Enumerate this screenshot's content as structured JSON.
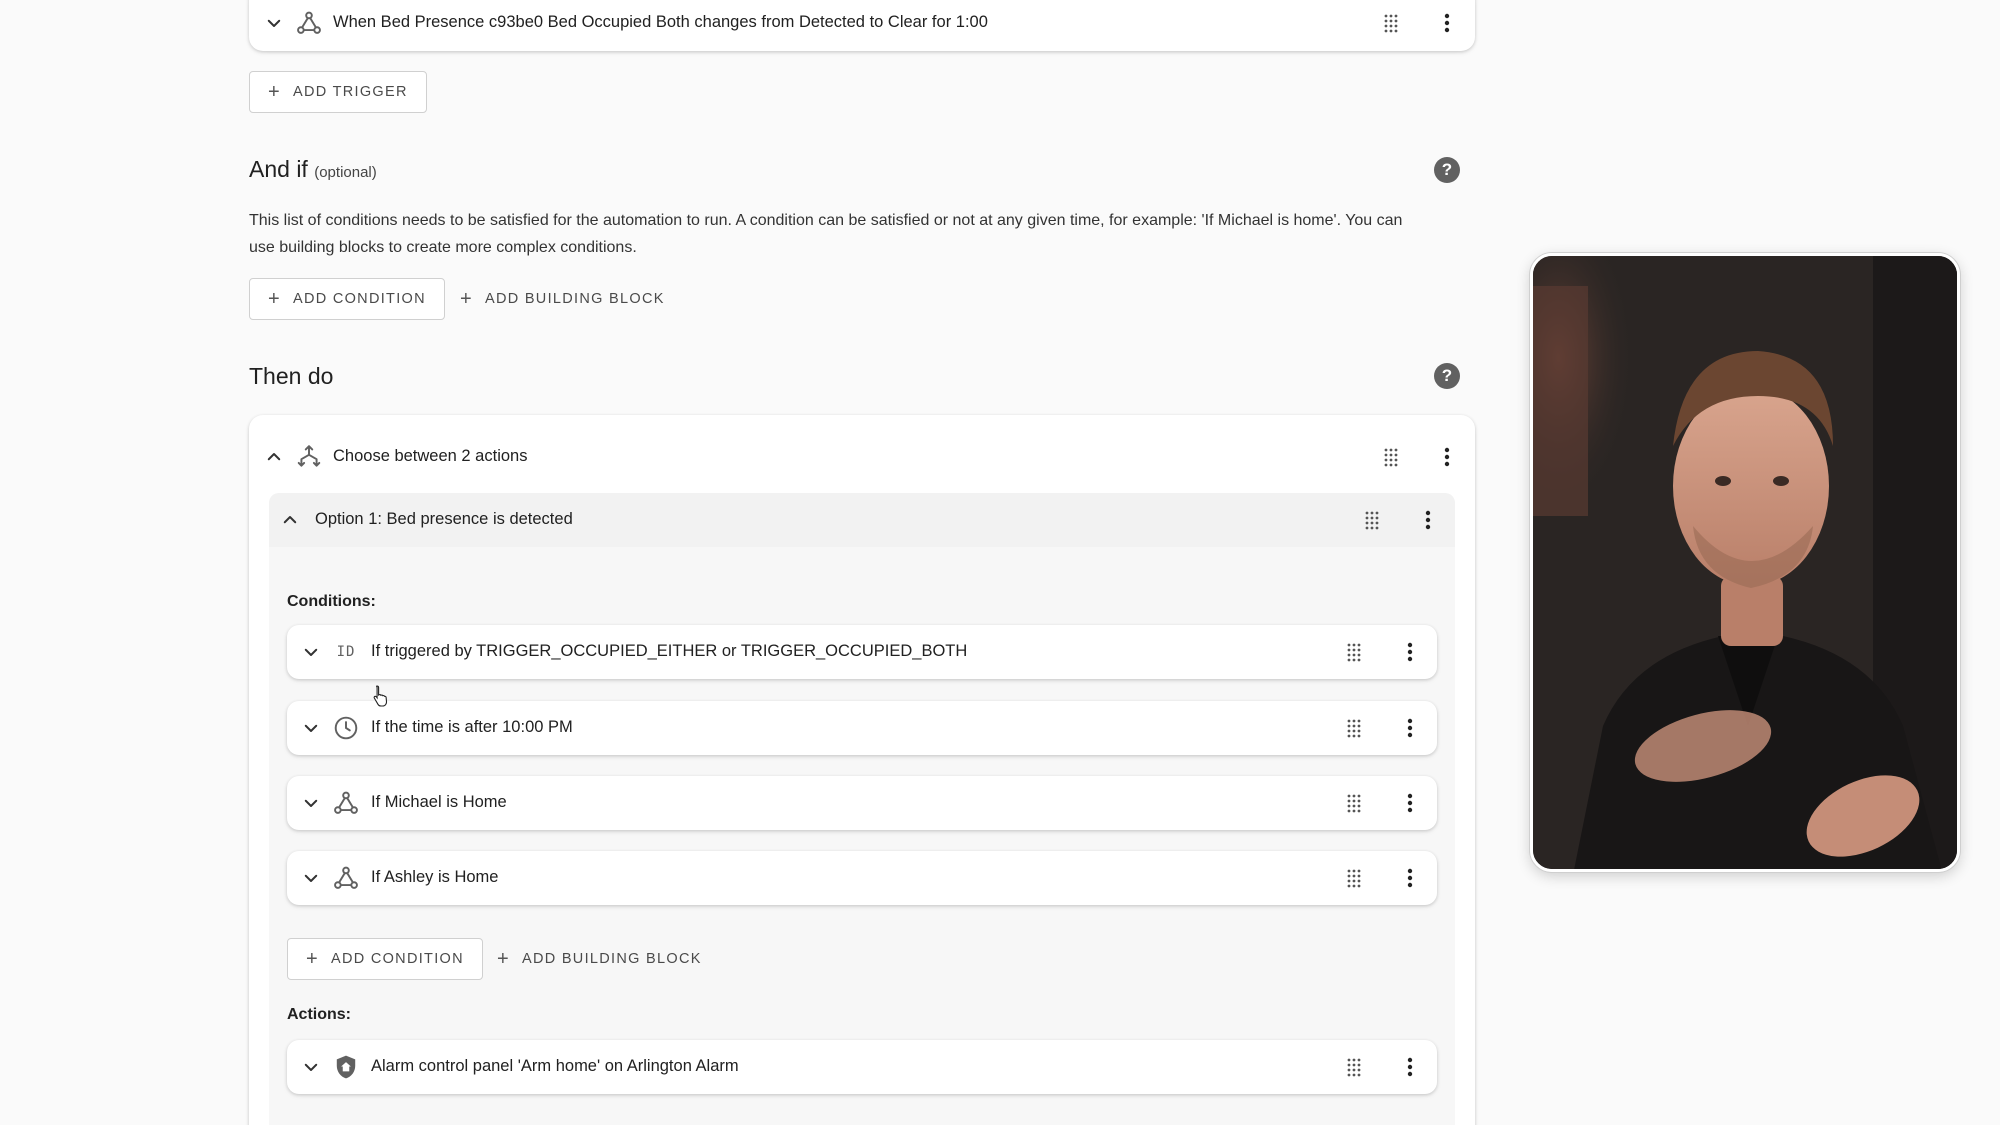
{
  "trigger": {
    "label": "When Bed Presence c93be0 Bed Occupied Both changes from Detected to Clear for 1:00",
    "add_trigger_label": "ADD TRIGGER"
  },
  "and_if": {
    "title": "And if",
    "optional": "(optional)",
    "description_line1": "This list of conditions needs to be satisfied for the automation to run. A condition can be satisfied or not at any given time, for example: 'If Michael is home'. You can",
    "description_line2": "use building blocks to create more complex conditions.",
    "add_condition_label": "ADD CONDITION",
    "add_building_block_label": "ADD BUILDING BLOCK"
  },
  "then_do": {
    "title": "Then do",
    "choose": {
      "label": "Choose between 2 actions",
      "option1": {
        "label": "Option 1: Bed presence is detected",
        "conditions_heading": "Conditions:",
        "conditions": [
          {
            "label": "If triggered by TRIGGER_OCCUPIED_EITHER or TRIGGER_OCCUPIED_BOTH",
            "icon": "id-icon"
          },
          {
            "label": "If the time is after 10:00 PM",
            "icon": "clock-icon"
          },
          {
            "label": "If Michael is Home",
            "icon": "device-hub-icon"
          },
          {
            "label": "If Ashley is Home",
            "icon": "device-hub-icon"
          }
        ],
        "add_condition_label": "ADD CONDITION",
        "add_building_block_label": "ADD BUILDING BLOCK",
        "actions_heading": "Actions:",
        "actions": [
          {
            "label": "Alarm control panel 'Arm home' on Arlington Alarm",
            "icon": "shield-home-icon"
          }
        ]
      }
    }
  },
  "icons": {
    "id_glyph": "ID"
  },
  "colors": {
    "background": "#fafafa",
    "card": "#ffffff",
    "icon": "#616161",
    "help": "#616161"
  }
}
